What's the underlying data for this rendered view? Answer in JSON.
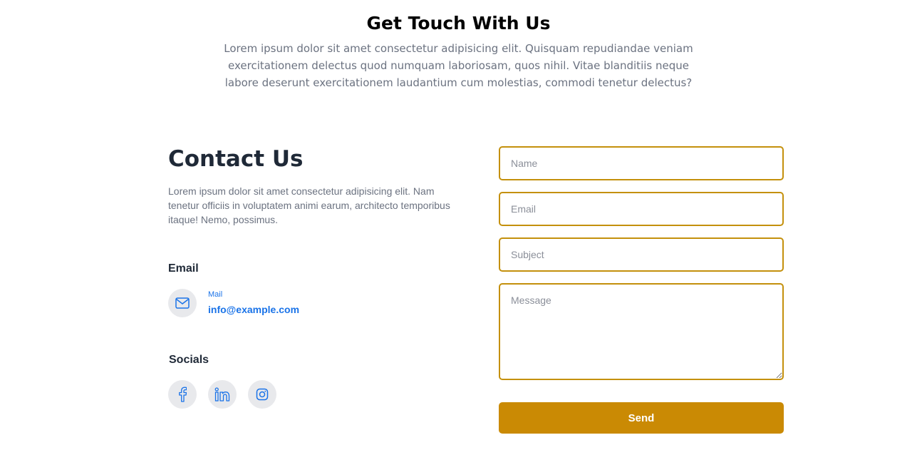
{
  "hero": {
    "title": "Get Touch With Us",
    "text": "Lorem ipsum dolor sit amet consectetur adipisicing elit. Quisquam repudiandae veniam exercitationem delectus quod numquam laboriosam, quos nihil. Vitae blanditiis neque labore deserunt exercitationem laudantium cum molestias, commodi tenetur delectus?"
  },
  "contact": {
    "title": "Contact Us",
    "text": "Lorem ipsum dolor sit amet consectetur adipisicing elit. Nam tenetur officiis in voluptatem animi earum, architecto temporibus itaque! Nemo, possimus.",
    "email_heading": "Email",
    "mail_label": "Mail",
    "mail_value": "info@example.com",
    "socials_heading": "Socials",
    "socials": [
      {
        "icon": "facebook-icon"
      },
      {
        "icon": "linkedin-icon"
      },
      {
        "icon": "instagram-icon"
      }
    ]
  },
  "form": {
    "name_placeholder": "Name",
    "email_placeholder": "Email",
    "subject_placeholder": "Subject",
    "message_placeholder": "Message",
    "send_label": "Send"
  },
  "colors": {
    "accent": "#ca8a04",
    "link": "#1a73e8",
    "heading": "#1f2937",
    "muted_text": "#6b7280"
  }
}
